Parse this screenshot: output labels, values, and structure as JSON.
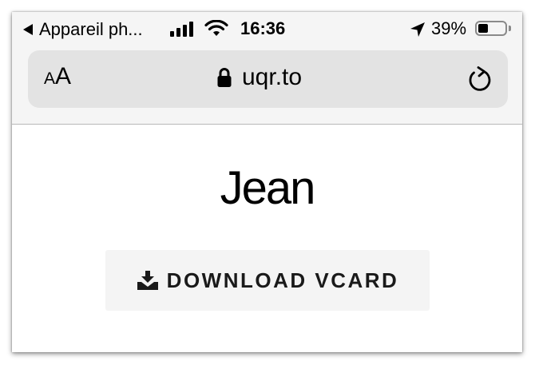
{
  "status_bar": {
    "back_app_label": "Appareil ph...",
    "time": "16:36",
    "battery_percent": "39%",
    "battery_level": 0.39,
    "signal_bars": 4,
    "icons": [
      "back-caret-icon",
      "cellular-signal-icon",
      "wifi-icon",
      "location-arrow-icon",
      "battery-icon"
    ]
  },
  "address_bar": {
    "text_size_small": "A",
    "text_size_large": "A",
    "url": "uqr.to",
    "icons": [
      "lock-icon",
      "reload-icon"
    ]
  },
  "page": {
    "name": "Jean",
    "download_button_label": "DOWNLOAD VCARD",
    "download_icon": "download-tray-icon"
  },
  "colors": {
    "chrome_background": "#f5f5f5",
    "address_bar_background": "#e3e3e3",
    "button_background": "#f4f4f4",
    "text": "#000000"
  }
}
